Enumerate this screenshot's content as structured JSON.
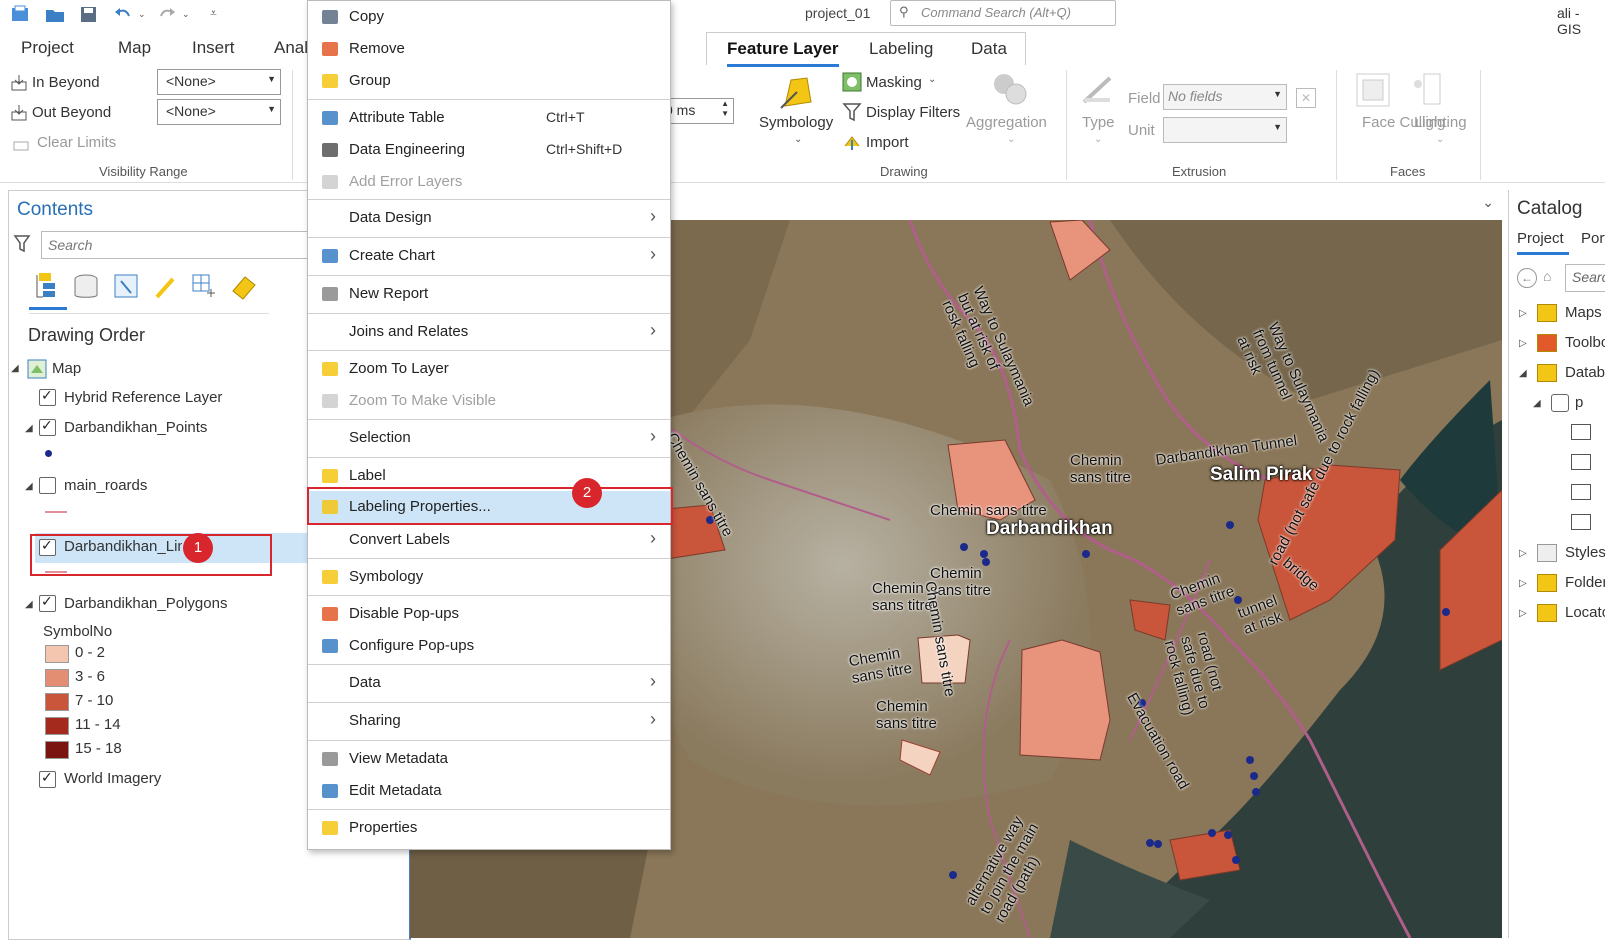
{
  "app": {
    "project_title": "project_01",
    "command_search_placeholder": "Command Search (Alt+Q)",
    "user": "ali - GIS"
  },
  "menu_tabs": [
    "Project",
    "Map",
    "Insert",
    "Anal"
  ],
  "ribbon": {
    "visibility": {
      "in_beyond": "In Beyond",
      "out_beyond": "Out Beyond",
      "clear_limits": "Clear Limits",
      "in_value": "<None>",
      "out_value": "<None>",
      "group_label": "Visibility Range"
    },
    "time_value": "0  ms",
    "context_tabs": [
      "Feature Layer",
      "Labeling",
      "Data"
    ],
    "drawing": {
      "symbology": "Symbology",
      "masking": "Masking",
      "display_filters": "Display Filters",
      "import": "Import",
      "aggregation": "Aggregation",
      "group_label": "Drawing"
    },
    "extrusion": {
      "type": "Type",
      "field_label": "Field",
      "field_value": "No fields",
      "unit_label": "Unit",
      "group_label": "Extrusion"
    },
    "faces": {
      "face_culling": "Face Culling",
      "lighting": "Lighting",
      "group_label": "Faces"
    }
  },
  "contents": {
    "title": "Contents",
    "search_placeholder": "Search",
    "section_title": "Drawing Order",
    "map_label": "Map",
    "layers": {
      "hybrid": "Hybrid Reference Layer",
      "points": "Darbandikhan_Points",
      "roads": "main_roards",
      "lines": "Darbandikhan_Lines",
      "polygons": "Darbandikhan_Polygons",
      "world": "World Imagery"
    },
    "legend_field": "SymbolNo",
    "legend": [
      {
        "label": "0 - 2",
        "color": "#f4c6b0"
      },
      {
        "label": "3 - 6",
        "color": "#e38e72"
      },
      {
        "label": "7 - 10",
        "color": "#c9553a"
      },
      {
        "label": "11 - 14",
        "color": "#a32a1c"
      },
      {
        "label": "15 - 18",
        "color": "#7a1410"
      }
    ]
  },
  "context_menu": {
    "items": [
      {
        "label": "Copy"
      },
      {
        "label": "Remove"
      },
      {
        "label": "Group"
      },
      {
        "label": "Attribute Table",
        "shortcut": "Ctrl+T"
      },
      {
        "label": "Data Engineering",
        "shortcut": "Ctrl+Shift+D"
      },
      {
        "label": "Add Error Layers"
      },
      {
        "label": "Data Design"
      },
      {
        "label": "Create Chart"
      },
      {
        "label": "New Report"
      },
      {
        "label": "Joins and Relates"
      },
      {
        "label": "Zoom To Layer"
      },
      {
        "label": "Zoom To Make Visible"
      },
      {
        "label": "Selection"
      },
      {
        "label": "Label"
      },
      {
        "label": "Labeling Properties..."
      },
      {
        "label": "Convert Labels"
      },
      {
        "label": "Symbology"
      },
      {
        "label": "Disable Pop-ups"
      },
      {
        "label": "Configure Pop-ups"
      },
      {
        "label": "Data"
      },
      {
        "label": "Sharing"
      },
      {
        "label": "View Metadata"
      },
      {
        "label": "Edit Metadata"
      },
      {
        "label": "Properties"
      }
    ]
  },
  "callouts": [
    "1",
    "2"
  ],
  "map_labels": {
    "darbandikhan": "Darbandikhan",
    "salim_pirak": "Salim Pirak",
    "chemin": "Chemin",
    "sans_titre": "sans titre",
    "chemin_sans_titre": "Chemin sans titre",
    "way_sulay_1": "Way to Sulaymania",
    "way_sulay_2": "but at risk of",
    "way_sulay_3": "rosk falling",
    "way_tunnel_1": "Way to Sulaymania",
    "way_tunnel_2": "from tunnel",
    "way_tunnel_3": "at risk",
    "darb_tunnel": "Darbandikhan Tunnel",
    "road_not_safe": "road (not safe due to rock falling)",
    "bridge": "bridge",
    "tunnel_at_risk_1": "tunnel",
    "tunnel_at_risk_2": "at risk",
    "evacuation": "Evacuation road",
    "alt_way_1": "alternative way",
    "alt_way_2": "to join the main",
    "alt_way_3": "road (path)",
    "road_not_1": "road (not",
    "road_not_2": "safe due to",
    "road_not_3": "rock falling)"
  },
  "catalog": {
    "title": "Catalog",
    "tab_project": "Project",
    "tab_portal": "Portal",
    "search_placeholder": "Search",
    "items": [
      "Maps",
      "Toolboxes",
      "Databases",
      "p",
      "Styles",
      "Folders",
      "Locators"
    ]
  },
  "colors": {
    "accent": "#2a7ad5",
    "callout": "#d9262c",
    "highlight": "#cde5f7",
    "polygon_light": "#e8937c",
    "polygon_dark": "#c9553a"
  }
}
